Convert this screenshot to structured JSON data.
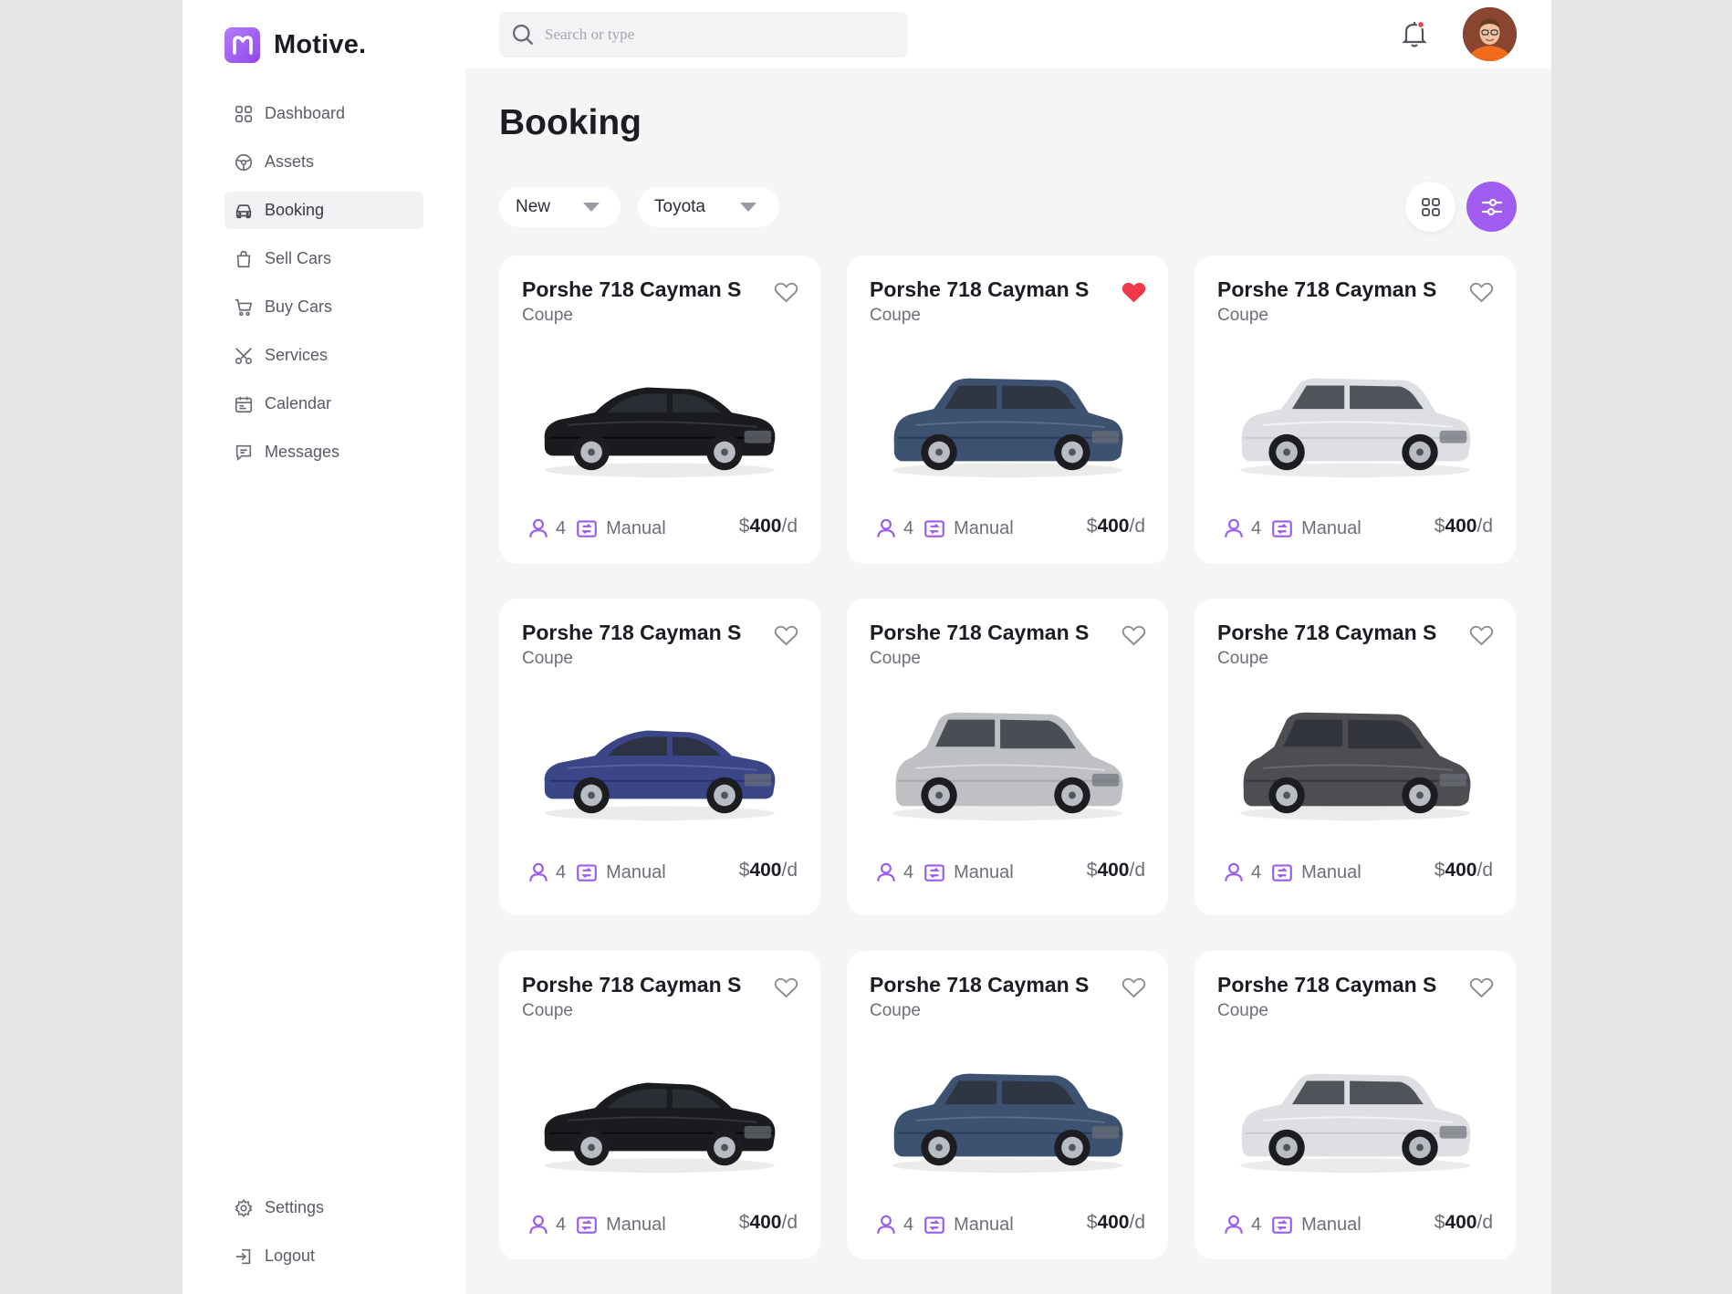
{
  "brand": {
    "name": "Motive.",
    "accent": "#a15cf2"
  },
  "nav": {
    "items": [
      {
        "label": "Dashboard",
        "icon": "grid-icon"
      },
      {
        "label": "Assets",
        "icon": "steering-icon"
      },
      {
        "label": "Booking",
        "icon": "car-icon",
        "active": true
      },
      {
        "label": "Sell Cars",
        "icon": "bag-icon"
      },
      {
        "label": "Buy Cars",
        "icon": "cart-icon"
      },
      {
        "label": "Services",
        "icon": "tools-icon"
      },
      {
        "label": "Calendar",
        "icon": "calendar-icon"
      },
      {
        "label": "Messages",
        "icon": "chat-icon"
      }
    ],
    "bottom": [
      {
        "label": "Settings",
        "icon": "gear-icon"
      },
      {
        "label": "Logout",
        "icon": "logout-icon"
      }
    ]
  },
  "search": {
    "placeholder": "Search or type"
  },
  "page": {
    "title": "Booking"
  },
  "filters": {
    "condition": "New",
    "make": "Toyota"
  },
  "cars": [
    {
      "name": "Porshe 718 Cayman S",
      "type": "Coupe",
      "seats": "4",
      "transmission": "Manual",
      "price": "400",
      "currency": "$",
      "unit": "/d",
      "favorite": false,
      "color": "#1b1b1f",
      "style": "sedan"
    },
    {
      "name": "Porshe 718 Cayman S",
      "type": "Coupe",
      "seats": "4",
      "transmission": "Manual",
      "price": "400",
      "currency": "$",
      "unit": "/d",
      "favorite": true,
      "color": "#3d5270",
      "style": "suv"
    },
    {
      "name": "Porshe 718 Cayman S",
      "type": "Coupe",
      "seats": "4",
      "transmission": "Manual",
      "price": "400",
      "currency": "$",
      "unit": "/d",
      "favorite": false,
      "color": "#dedfe2",
      "style": "suv"
    },
    {
      "name": "Porshe 718 Cayman S",
      "type": "Coupe",
      "seats": "4",
      "transmission": "Manual",
      "price": "400",
      "currency": "$",
      "unit": "/d",
      "favorite": false,
      "color": "#3b4688",
      "style": "sedan"
    },
    {
      "name": "Porshe 718 Cayman S",
      "type": "Coupe",
      "seats": "4",
      "transmission": "Manual",
      "price": "400",
      "currency": "$",
      "unit": "/d",
      "favorite": false,
      "color": "#bfc0c4",
      "style": "mpv"
    },
    {
      "name": "Porshe 718 Cayman S",
      "type": "Coupe",
      "seats": "4",
      "transmission": "Manual",
      "price": "400",
      "currency": "$",
      "unit": "/d",
      "favorite": false,
      "color": "#4d4d52",
      "style": "mpv"
    },
    {
      "name": "Porshe 718 Cayman S",
      "type": "Coupe",
      "seats": "4",
      "transmission": "Manual",
      "price": "400",
      "currency": "$",
      "unit": "/d",
      "favorite": false,
      "color": "#1b1b1f",
      "style": "sedan"
    },
    {
      "name": "Porshe 718 Cayman S",
      "type": "Coupe",
      "seats": "4",
      "transmission": "Manual",
      "price": "400",
      "currency": "$",
      "unit": "/d",
      "favorite": false,
      "color": "#3d5270",
      "style": "suv"
    },
    {
      "name": "Porshe 718 Cayman S",
      "type": "Coupe",
      "seats": "4",
      "transmission": "Manual",
      "price": "400",
      "currency": "$",
      "unit": "/d",
      "favorite": false,
      "color": "#dedfe2",
      "style": "suv"
    }
  ]
}
